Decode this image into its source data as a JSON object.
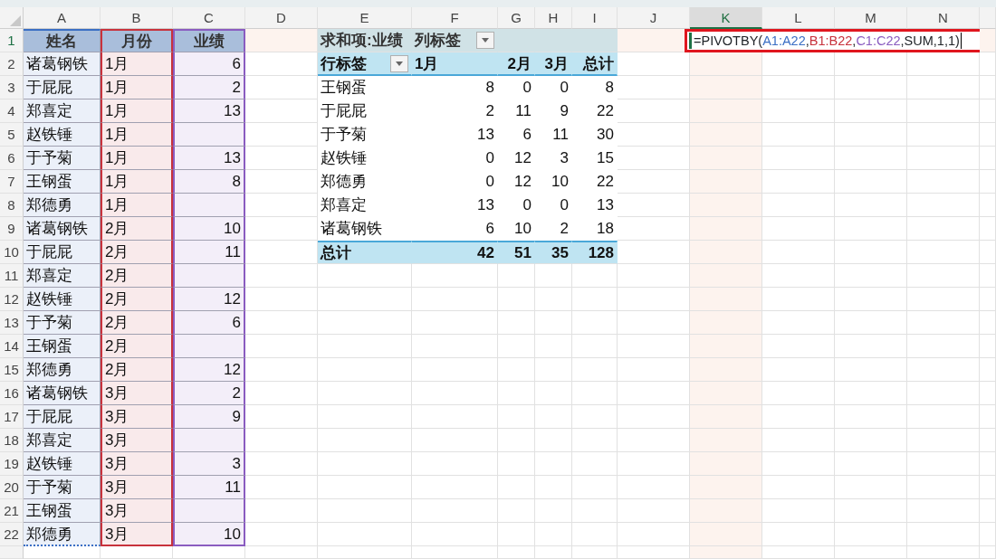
{
  "column_headers": [
    {
      "label": "A",
      "selected": false
    },
    {
      "label": "B",
      "selected": false
    },
    {
      "label": "C",
      "selected": false
    },
    {
      "label": "D",
      "selected": false
    },
    {
      "label": "E",
      "selected": false
    },
    {
      "label": "F",
      "selected": false
    },
    {
      "label": "G",
      "selected": false
    },
    {
      "label": "H",
      "selected": false
    },
    {
      "label": "I",
      "selected": false
    },
    {
      "label": "J",
      "selected": false
    },
    {
      "label": "K",
      "selected": true
    },
    {
      "label": "L",
      "selected": false
    },
    {
      "label": "M",
      "selected": false
    },
    {
      "label": "N",
      "selected": false
    }
  ],
  "row_headers": [
    {
      "label": "1",
      "selected": true
    },
    {
      "label": "2",
      "selected": false
    },
    {
      "label": "3",
      "selected": false
    },
    {
      "label": "4",
      "selected": false
    },
    {
      "label": "5",
      "selected": false
    },
    {
      "label": "6",
      "selected": false
    },
    {
      "label": "7",
      "selected": false
    },
    {
      "label": "8",
      "selected": false
    },
    {
      "label": "9",
      "selected": false
    },
    {
      "label": "10",
      "selected": false
    },
    {
      "label": "11",
      "selected": false
    },
    {
      "label": "12",
      "selected": false
    },
    {
      "label": "13",
      "selected": false
    },
    {
      "label": "14",
      "selected": false
    },
    {
      "label": "15",
      "selected": false
    },
    {
      "label": "16",
      "selected": false
    },
    {
      "label": "17",
      "selected": false
    },
    {
      "label": "18",
      "selected": false
    },
    {
      "label": "19",
      "selected": false
    },
    {
      "label": "20",
      "selected": false
    },
    {
      "label": "21",
      "selected": false
    },
    {
      "label": "22",
      "selected": false
    }
  ],
  "source_table": {
    "columns": [
      {
        "header": "姓名",
        "color": "#3b6fc4"
      },
      {
        "header": "月份",
        "color": "#c8323c"
      },
      {
        "header": "业绩",
        "color": "#8a5cc0"
      }
    ],
    "rows": [
      {
        "name": "诸葛钢铁",
        "month": "1月",
        "value": "6"
      },
      {
        "name": "于屁屁",
        "month": "1月",
        "value": "2"
      },
      {
        "name": "郑喜定",
        "month": "1月",
        "value": "13"
      },
      {
        "name": "赵铁锤",
        "month": "1月"
      },
      {
        "name": "于予菊",
        "month": "1月",
        "value": "13"
      },
      {
        "name": "王钢蛋",
        "month": "1月",
        "value": "8"
      },
      {
        "name": "郑德勇",
        "month": "1月"
      },
      {
        "name": "诸葛钢铁",
        "month": "2月",
        "value": "10"
      },
      {
        "name": "于屁屁",
        "month": "2月",
        "value": "11"
      },
      {
        "name": "郑喜定",
        "month": "2月"
      },
      {
        "name": "赵铁锤",
        "month": "2月",
        "value": "12"
      },
      {
        "name": "于予菊",
        "month": "2月",
        "value": "6"
      },
      {
        "name": "王钢蛋",
        "month": "2月"
      },
      {
        "name": "郑德勇",
        "month": "2月",
        "value": "12"
      },
      {
        "name": "诸葛钢铁",
        "month": "3月",
        "value": "2"
      },
      {
        "name": "于屁屁",
        "month": "3月",
        "value": "9"
      },
      {
        "name": "郑喜定",
        "month": "3月"
      },
      {
        "name": "赵铁锤",
        "month": "3月",
        "value": "3"
      },
      {
        "name": "于予菊",
        "month": "3月",
        "value": "11"
      },
      {
        "name": "王钢蛋",
        "month": "3月"
      },
      {
        "name": "郑德勇",
        "month": "3月",
        "value": "10"
      }
    ]
  },
  "pivot_table": {
    "value_label": "求和项:业绩",
    "column_label": "列标签",
    "row_label": "行标签",
    "column_headers": [
      "1月",
      "2月",
      "3月",
      "总计"
    ],
    "rows": [
      {
        "name": "王钢蛋",
        "values": [
          "8",
          "0",
          "0",
          "8"
        ]
      },
      {
        "name": "于屁屁",
        "values": [
          "2",
          "11",
          "9",
          "22"
        ]
      },
      {
        "name": "于予菊",
        "values": [
          "13",
          "6",
          "11",
          "30"
        ]
      },
      {
        "name": "赵铁锤",
        "values": [
          "0",
          "12",
          "3",
          "15"
        ]
      },
      {
        "name": "郑德勇",
        "values": [
          "0",
          "12",
          "10",
          "22"
        ]
      },
      {
        "name": "郑喜定",
        "values": [
          "13",
          "0",
          "0",
          "13"
        ]
      },
      {
        "name": "诸葛钢铁",
        "values": [
          "6",
          "10",
          "2",
          "18"
        ]
      }
    ],
    "total": {
      "label": "总计",
      "values": [
        "42",
        "51",
        "35",
        "128"
      ]
    }
  },
  "formula": {
    "tokens": [
      {
        "text": "=PIVOTBY("
      },
      {
        "text": "A1:A22",
        "color": "#3b6fc4"
      },
      {
        "text": ","
      },
      {
        "text": "B1:B22",
        "color": "#c8323c"
      },
      {
        "text": ","
      },
      {
        "text": "C1:C22",
        "color": "#8a5cc0"
      },
      {
        "text": ",SUM,1,1)"
      }
    ]
  }
}
